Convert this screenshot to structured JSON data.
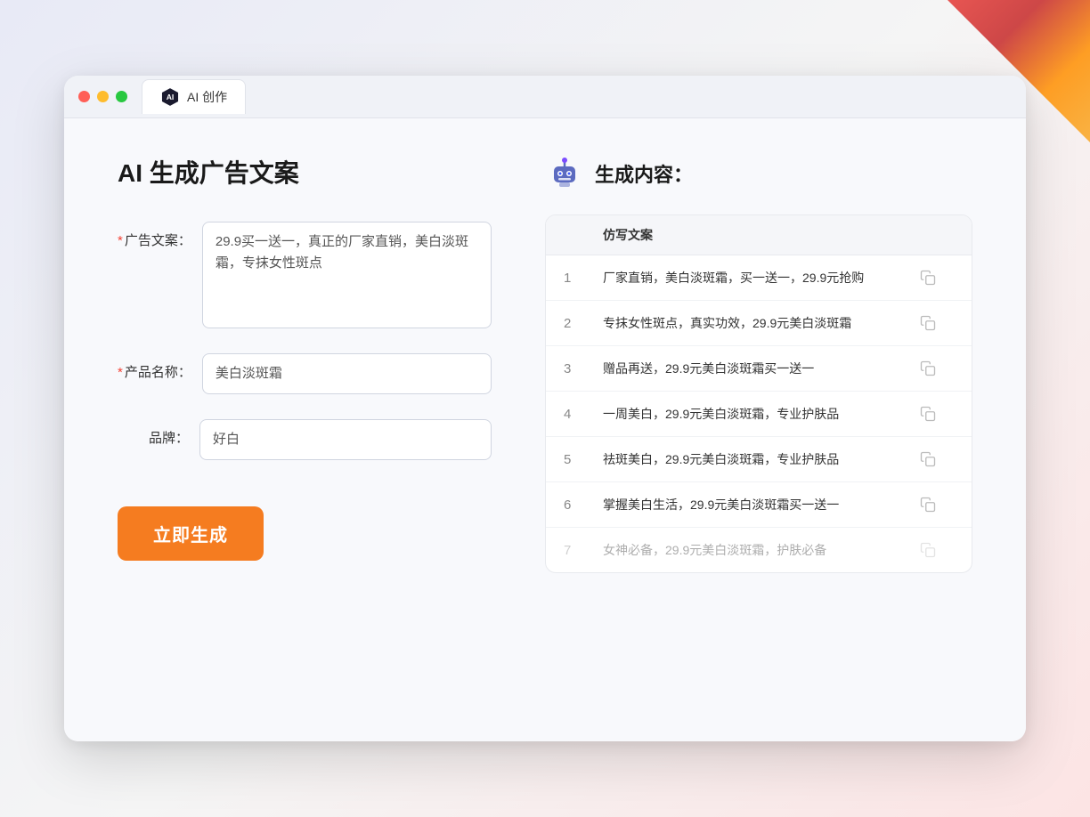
{
  "window": {
    "tab_label": "AI 创作"
  },
  "page": {
    "title": "AI 生成广告文案"
  },
  "form": {
    "ad_copy_label": "广告文案：",
    "ad_copy_required": "＊",
    "ad_copy_value": "29.9买一送一，真正的厂家直销，美白淡斑霜，专抹女性斑点",
    "product_name_label": "产品名称：",
    "product_name_required": "＊",
    "product_name_value": "美白淡斑霜",
    "brand_label": "品牌：",
    "brand_value": "好白",
    "generate_button": "立即生成"
  },
  "result": {
    "header": "生成内容：",
    "column_label": "仿写文案",
    "rows": [
      {
        "num": "1",
        "text": "厂家直销，美白淡斑霜，买一送一，29.9元抢购",
        "faded": false
      },
      {
        "num": "2",
        "text": "专抹女性斑点，真实功效，29.9元美白淡斑霜",
        "faded": false
      },
      {
        "num": "3",
        "text": "赠品再送，29.9元美白淡斑霜买一送一",
        "faded": false
      },
      {
        "num": "4",
        "text": "一周美白，29.9元美白淡斑霜，专业护肤品",
        "faded": false
      },
      {
        "num": "5",
        "text": "祛斑美白，29.9元美白淡斑霜，专业护肤品",
        "faded": false
      },
      {
        "num": "6",
        "text": "掌握美白生活，29.9元美白淡斑霜买一送一",
        "faded": false
      },
      {
        "num": "7",
        "text": "女神必备，29.9元美白淡斑霜，护肤必备",
        "faded": true
      }
    ]
  },
  "colors": {
    "orange": "#f57c20",
    "red_required": "#f44336",
    "robot_purple": "#6c4fc7",
    "robot_blue": "#3d6bec"
  }
}
